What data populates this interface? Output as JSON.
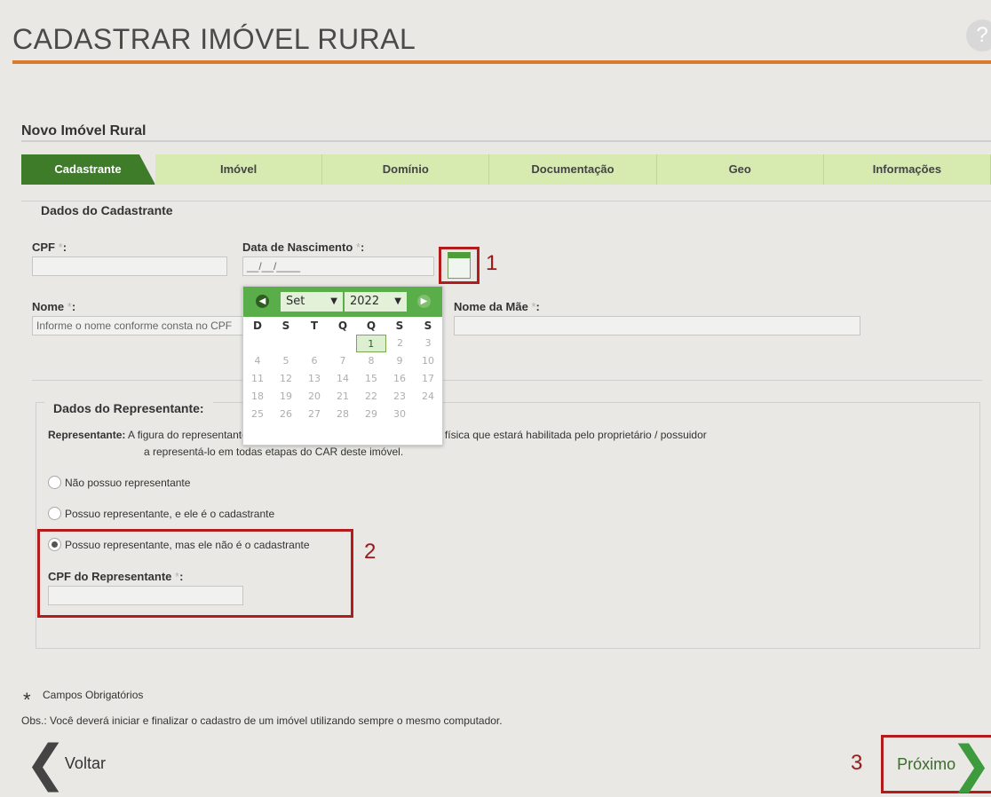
{
  "page": {
    "title": "CADASTRAR IMÓVEL RURAL",
    "help_icon": "?"
  },
  "section": {
    "title": "Novo Imóvel Rural"
  },
  "tabs": [
    {
      "label": "Cadastrante",
      "active": true
    },
    {
      "label": "Imóvel"
    },
    {
      "label": "Domínio"
    },
    {
      "label": "Documentação"
    },
    {
      "label": "Geo"
    },
    {
      "label": "Informações"
    }
  ],
  "dados_cadastrante": {
    "title": "Dados do Cadastrante",
    "cpf": {
      "label": "CPF",
      "required": "*",
      "colon": ":",
      "value": ""
    },
    "data_nascimento": {
      "label": "Data de Nascimento",
      "required": "*",
      "colon": ":",
      "value": "__/__/____"
    },
    "nome": {
      "label": "Nome",
      "required": "*",
      "colon": ":",
      "placeholder": "Informe o nome conforme consta no CPF"
    },
    "nome_mae": {
      "label": "Nome da Mãe",
      "required": "*",
      "colon": ":",
      "value": ""
    }
  },
  "datepicker": {
    "month": "Set",
    "year": "2022",
    "weekdays": [
      "D",
      "S",
      "T",
      "Q",
      "Q",
      "S",
      "S"
    ],
    "weeks": [
      [
        "",
        "",
        "",
        "",
        "",
        "1",
        "2",
        "3"
      ],
      [
        "4",
        "5",
        "6",
        "7",
        "8",
        "9",
        "10"
      ],
      [
        "11",
        "12",
        "13",
        "14",
        "15",
        "16",
        "17"
      ],
      [
        "18",
        "19",
        "20",
        "21",
        "22",
        "23",
        "24"
      ],
      [
        "25",
        "26",
        "27",
        "28",
        "29",
        "30",
        ""
      ]
    ],
    "selected": "1"
  },
  "annotations": {
    "one": "1",
    "two": "2",
    "three": "3"
  },
  "dados_representante": {
    "title": "Dados do Representante:",
    "desc_label": "Representante:",
    "desc_line1": "A figura do representante no Cadastro Ambiental Rural é a pessoa física que estará habilitada pelo proprietário / possuidor",
    "desc_line2": "a representá-lo em todas etapas do CAR deste imóvel.",
    "options": [
      {
        "label": "Não possuo representante",
        "selected": false
      },
      {
        "label": "Possuo representante, e ele é o cadastrante",
        "selected": false
      },
      {
        "label": "Possuo representante, mas ele não é o cadastrante",
        "selected": true
      }
    ],
    "cpf_representante": {
      "label": "CPF do Representante",
      "required": "*",
      "colon": ":",
      "value": ""
    }
  },
  "footer": {
    "star": "*",
    "required_text": "Campos Obrigatórios",
    "obs": "Obs.: Você deverá iniciar e finalizar o cadastro de um imóvel utilizando sempre o mesmo computador.",
    "back_label": "Voltar",
    "next_label": "Próximo"
  },
  "colors": {
    "accent_orange": "#d87b2f",
    "tab_active": "#3f7c2a",
    "tab_inactive": "#d7eab0",
    "annotation_red": "#b21c1c",
    "datepicker_header": "#5aae49"
  }
}
